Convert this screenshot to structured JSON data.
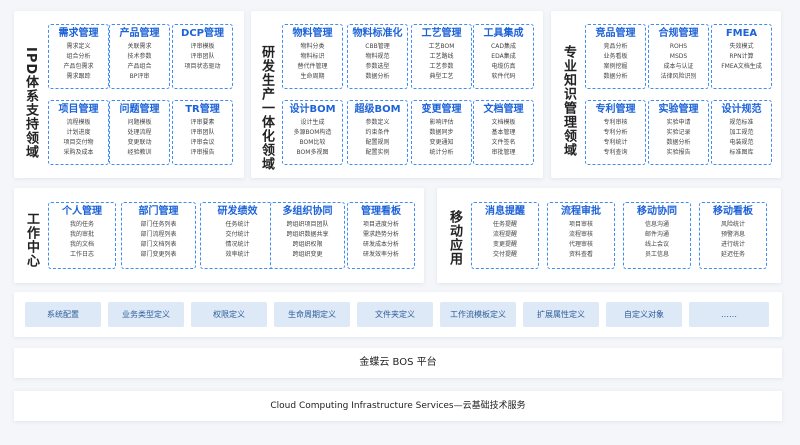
{
  "panels": {
    "ipd": {
      "label": "IPD体系支持领域",
      "cards": [
        {
          "title": "需求管理",
          "items": [
            "需求定义",
            "组合分析",
            "产品包需求",
            "需求跟踪"
          ]
        },
        {
          "title": "产品管理",
          "items": [
            "关联需求",
            "技术参数",
            "产品组合",
            "BP评审"
          ]
        },
        {
          "title": "DCP管理",
          "items": [
            "评审模板",
            "评审团队",
            "项目状态驱动"
          ]
        },
        {
          "title": "项目管理",
          "items": [
            "流程模板",
            "计划进度",
            "项目交付物",
            "采购及成本"
          ]
        },
        {
          "title": "问题管理",
          "items": [
            "问题模板",
            "处理流程",
            "变更联动",
            "经验教训"
          ]
        },
        {
          "title": "TR管理",
          "items": [
            "评审要素",
            "评审团队",
            "评审会议",
            "评审报告"
          ]
        }
      ]
    },
    "rnd": {
      "label": "研发生产一体化领域",
      "cards": [
        {
          "title": "物料管理",
          "items": [
            "物料分类",
            "物料标识",
            "替代件管理",
            "生命周期"
          ]
        },
        {
          "title": "物料标准化",
          "items": [
            "CBB管理",
            "物料规范",
            "参数选型",
            "数据分析"
          ]
        },
        {
          "title": "工艺管理",
          "items": [
            "工艺BOM",
            "工艺路线",
            "工艺参数",
            "典型工艺"
          ]
        },
        {
          "title": "工具集成",
          "items": [
            "CAD集成",
            "EDA集成",
            "电缆仿真",
            "软件代码"
          ]
        },
        {
          "title": "设计BOM",
          "items": [
            "设计生成",
            "多源BOM构造",
            "BOM比较",
            "BOM多视图"
          ]
        },
        {
          "title": "超级BOM",
          "items": [
            "参数定义",
            "约束条件",
            "配置规则",
            "配置实例"
          ]
        },
        {
          "title": "变更管理",
          "items": [
            "影响评估",
            "数据同步",
            "变更通知",
            "统计分析"
          ]
        },
        {
          "title": "文档管理",
          "items": [
            "文档模板",
            "基本管理",
            "文件签名",
            "审批管理"
          ]
        }
      ]
    },
    "knowledge": {
      "label": "专业知识管理领域",
      "cards": [
        {
          "title": "竞品管理",
          "items": [
            "竞品分析",
            "业务看板",
            "案例挖掘",
            "数据分析"
          ]
        },
        {
          "title": "合规管理",
          "items": [
            "ROHS",
            "MSDS",
            "成本与认证",
            "法律风险识别"
          ]
        },
        {
          "title": "FMEA",
          "items": [
            "失效模式",
            "RPN计算",
            "FMEA文档生成"
          ]
        },
        {
          "title": "专利管理",
          "items": [
            "专利审核",
            "专利分析",
            "专利统计",
            "专利查询"
          ]
        },
        {
          "title": "实验管理",
          "items": [
            "实验申请",
            "实验记录",
            "数据分析",
            "实验报告"
          ]
        },
        {
          "title": "设计规范",
          "items": [
            "规范标准",
            "加工规范",
            "电装规范",
            "标准图库"
          ]
        }
      ]
    },
    "work": {
      "label": "工作中心",
      "cards": [
        {
          "title": "个人管理",
          "items": [
            "我的任务",
            "我的审批",
            "我的文档",
            "工作日志"
          ]
        },
        {
          "title": "部门管理",
          "items": [
            "部门任务列表",
            "部门流程列表",
            "部门文档列表",
            "部门变更列表"
          ]
        },
        {
          "title": "研发绩效",
          "items": [
            "任务统计",
            "交付统计",
            "情况统计",
            "效率统计"
          ]
        },
        {
          "title": "多组织协同",
          "items": [
            "跨组织项目团队",
            "跨组织数据共享",
            "跨组织权限",
            "跨组织变更"
          ]
        },
        {
          "title": "管理看板",
          "items": [
            "项目进度分析",
            "需求趋势分析",
            "研发成本分析",
            "研发效率分析"
          ]
        }
      ]
    },
    "mobile": {
      "label": "移动应用",
      "cards": [
        {
          "title": "消息提醒",
          "items": [
            "任务提醒",
            "流程提醒",
            "变更提醒",
            "交付提醒"
          ]
        },
        {
          "title": "流程审批",
          "items": [
            "项目审核",
            "流程审核",
            "代理审核",
            "资料查看"
          ]
        },
        {
          "title": "移动协同",
          "items": [
            "信息沟通",
            "邮件沟通",
            "线上会议",
            "员工信息"
          ]
        },
        {
          "title": "移动看板",
          "items": [
            "风险统计",
            "预警消息",
            "进行统计",
            "延迟任务"
          ]
        }
      ]
    }
  },
  "config_bar": [
    "系统配置",
    "业务类型定义",
    "权限定义",
    "生命周期定义",
    "文件夹定义",
    "工作流模板定义",
    "扩展属性定义",
    "自定义对象",
    "……"
  ],
  "platform": "金蝶云 BOS 平台",
  "infrastructure": "Cloud Computing Infrastructure Services—云基础技术服务"
}
